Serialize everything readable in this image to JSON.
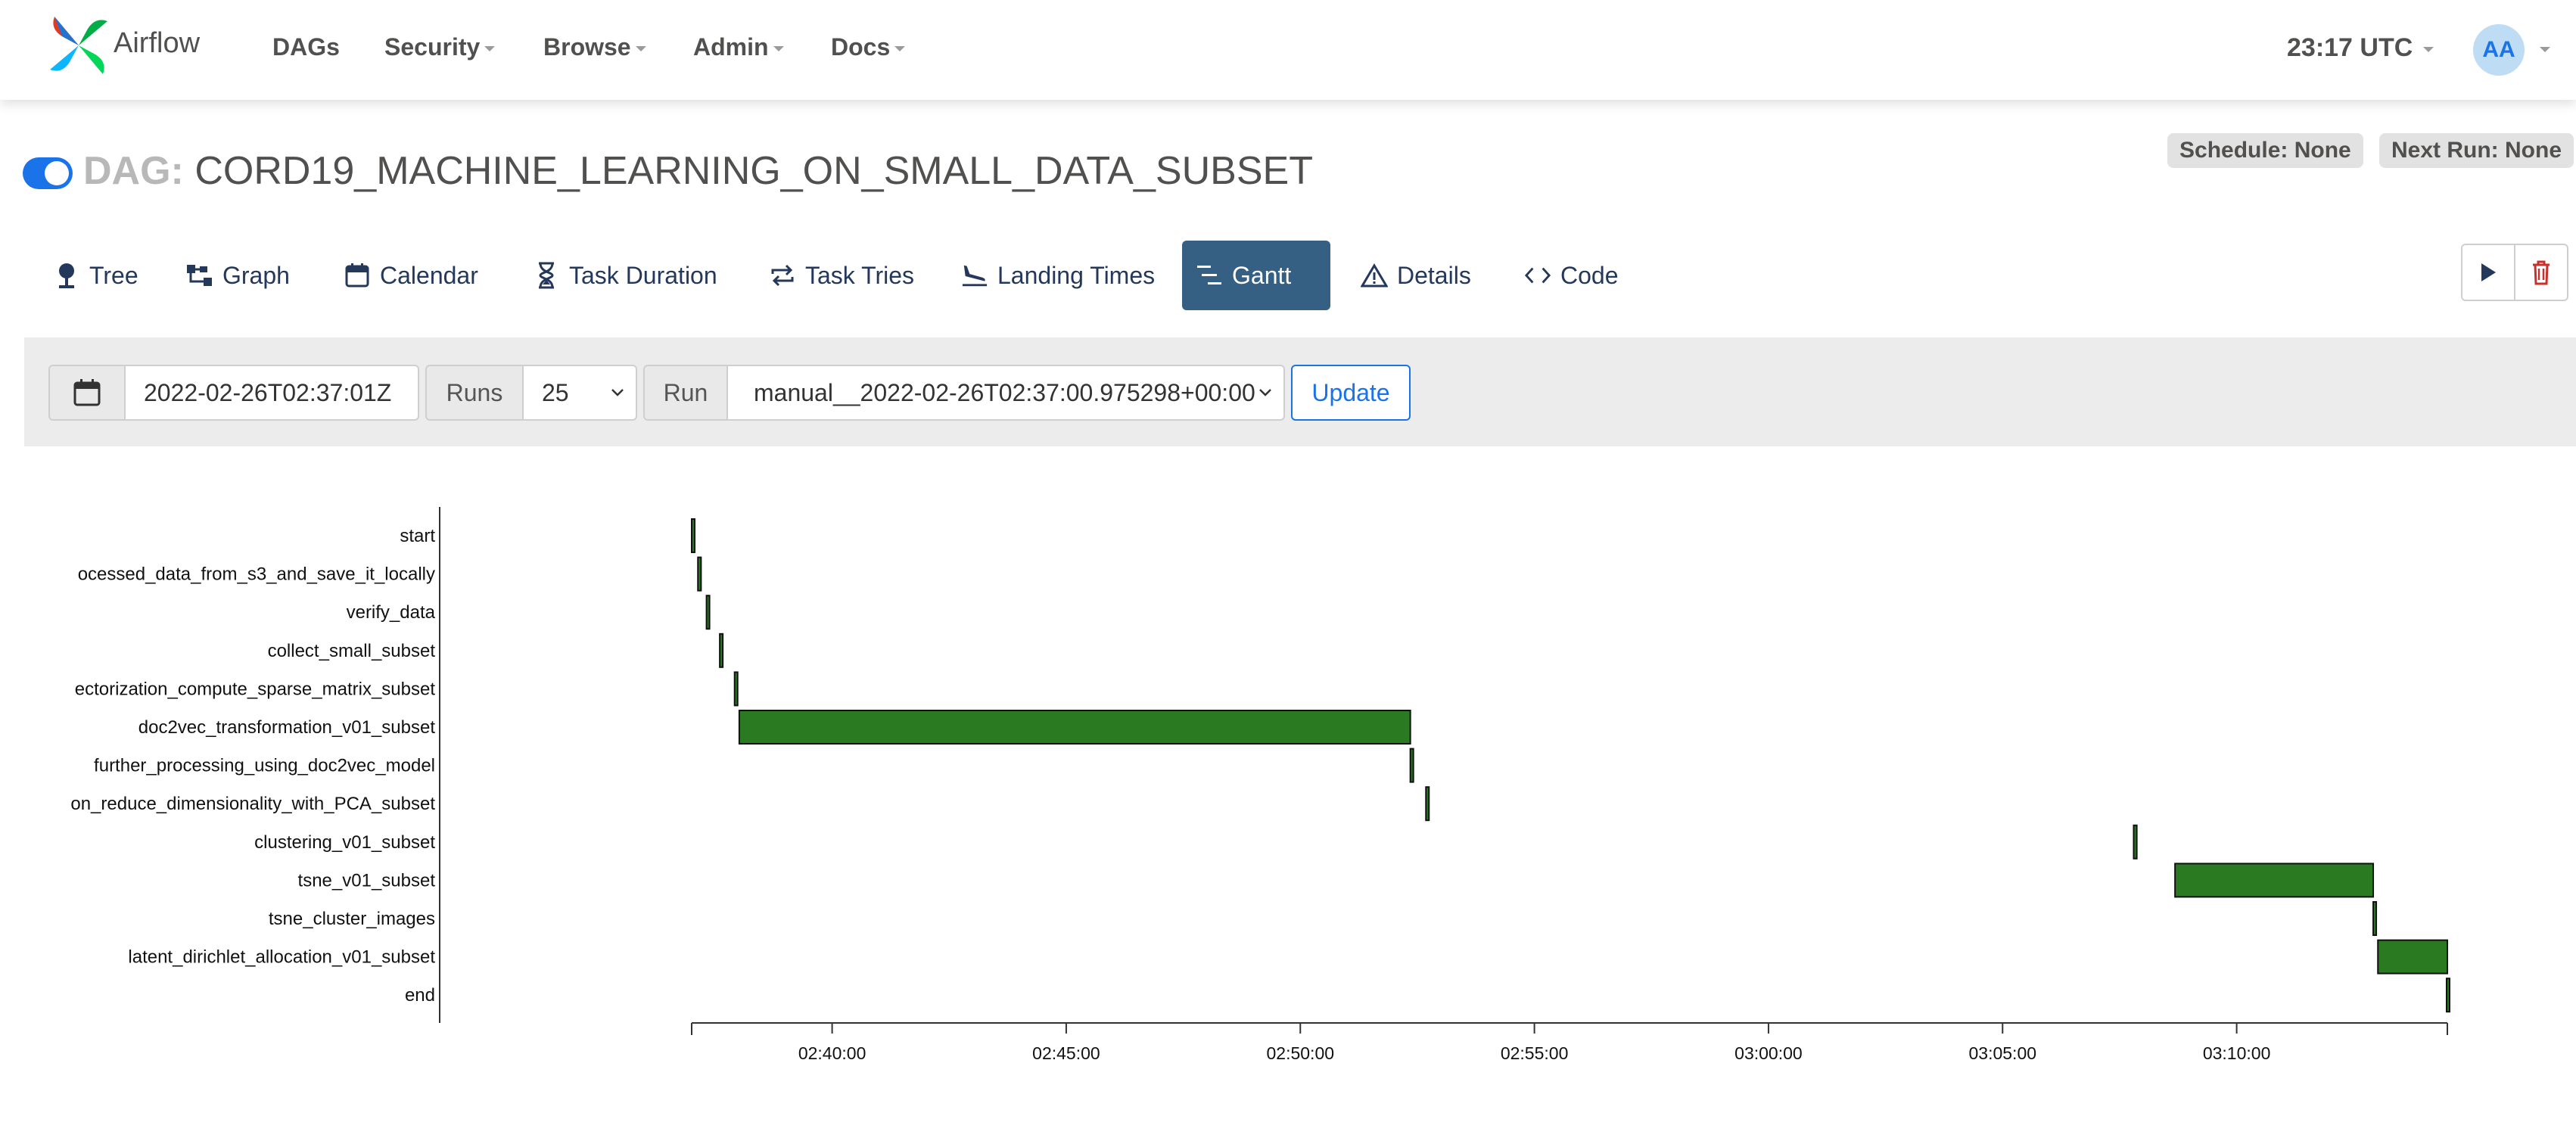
{
  "navbar": {
    "brand": "Airflow",
    "items": [
      {
        "label": "DAGs",
        "dropdown": false
      },
      {
        "label": "Security",
        "dropdown": true
      },
      {
        "label": "Browse",
        "dropdown": true
      },
      {
        "label": "Admin",
        "dropdown": true
      },
      {
        "label": "Docs",
        "dropdown": true
      }
    ],
    "clock": "23:17 UTC",
    "avatar_initials": "AA"
  },
  "dag": {
    "prefix": "DAG:",
    "name": "CORD19_MACHINE_LEARNING_ON_SMALL_DATA_SUBSET",
    "paused": false,
    "schedule": "Schedule: None",
    "next_run": "Next Run: None"
  },
  "tabs": [
    {
      "label": "Tree",
      "icon": "tree-icon",
      "active": false
    },
    {
      "label": "Graph",
      "icon": "graph-icon",
      "active": false
    },
    {
      "label": "Calendar",
      "icon": "calendar-icon",
      "active": false
    },
    {
      "label": "Task Duration",
      "icon": "hourglass-icon",
      "active": false
    },
    {
      "label": "Task Tries",
      "icon": "retry-icon",
      "active": false
    },
    {
      "label": "Landing Times",
      "icon": "plane-landing-icon",
      "active": false
    },
    {
      "label": "Gantt",
      "icon": "gantt-icon",
      "active": true
    },
    {
      "label": "Details",
      "icon": "warning-triangle-icon",
      "active": false
    },
    {
      "label": "Code",
      "icon": "code-icon",
      "active": false
    }
  ],
  "actions": {
    "trigger_icon": "play-icon",
    "delete_icon": "trash-icon"
  },
  "filters": {
    "base_date": "2022-02-26T02:37:01Z",
    "runs_label": "Runs",
    "runs_value": "25",
    "run_label": "Run",
    "run_value": "manual__2022-02-26T02:37:00.975298+00:00",
    "update_label": "Update"
  },
  "colors": {
    "success": "#2a7a22",
    "accent": "#1a73e8",
    "active_tab": "#365f84"
  },
  "chart_data": {
    "type": "gantt",
    "x_range": [
      "02:37:00",
      "03:14:30"
    ],
    "tick_labels": [
      "02:40:00",
      "02:45:00",
      "02:50:00",
      "02:55:00",
      "03:00:00",
      "03:05:00",
      "03:10:00"
    ],
    "tasks": [
      {
        "label": "start",
        "start": "02:37:00",
        "end": "02:37:01"
      },
      {
        "label": "ocessed_data_from_s3_and_save_it_locally",
        "start": "02:37:08",
        "end": "02:37:12"
      },
      {
        "label": "verify_data",
        "start": "02:37:19",
        "end": "02:37:22"
      },
      {
        "label": "collect_small_subset",
        "start": "02:37:36",
        "end": "02:37:38"
      },
      {
        "label": "ectorization_compute_sparse_matrix_subset",
        "start": "02:37:55",
        "end": "02:37:57"
      },
      {
        "label": "doc2vec_transformation_v01_subset",
        "start": "02:38:01",
        "end": "02:52:21"
      },
      {
        "label": "further_processing_using_doc2vec_model",
        "start": "02:52:21",
        "end": "02:52:23"
      },
      {
        "label": "on_reduce_dimensionality_with_PCA_subset",
        "start": "02:52:41",
        "end": "02:52:43"
      },
      {
        "label": "clustering_v01_subset",
        "start": "03:07:48",
        "end": "03:07:52"
      },
      {
        "label": "tsne_v01_subset",
        "start": "03:08:41",
        "end": "03:12:55"
      },
      {
        "label": "tsne_cluster_images",
        "start": "03:12:55",
        "end": "03:12:57"
      },
      {
        "label": "latent_dirichlet_allocation_v01_subset",
        "start": "03:13:01",
        "end": "03:14:30"
      },
      {
        "label": "end",
        "start": "03:14:29",
        "end": "03:14:30"
      }
    ]
  }
}
